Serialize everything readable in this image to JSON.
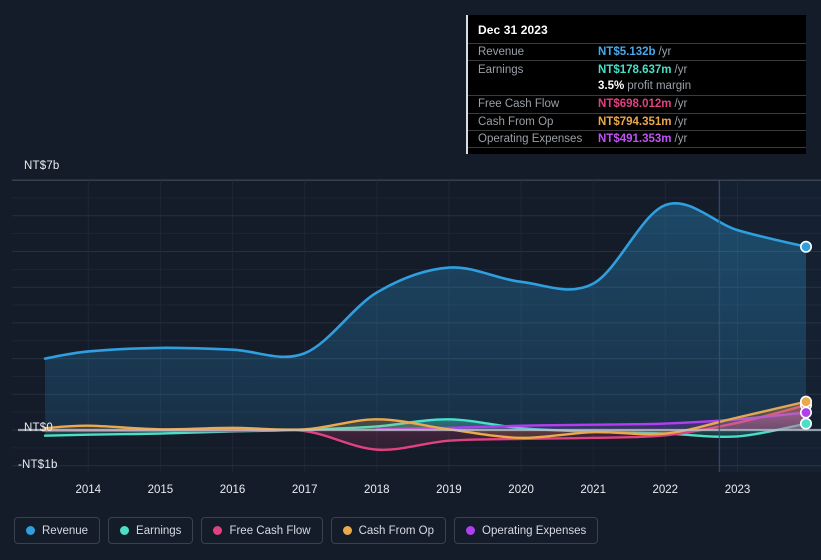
{
  "chart_data": {
    "type": "area",
    "title": "",
    "xlabel": "",
    "ylabel": "",
    "currency": "NT$",
    "ylim": [
      -1,
      7
    ],
    "y_ticks": [
      {
        "label": "NT$7b",
        "value": 7
      },
      {
        "label": "NT$0",
        "value": 0
      },
      {
        "label": "-NT$1b",
        "value": -1
      }
    ],
    "grid": true,
    "legend_position": "bottom",
    "categories": [
      "2014",
      "2015",
      "2016",
      "2017",
      "2018",
      "2019",
      "2020",
      "2021",
      "2022",
      "2023"
    ],
    "x": [
      2013.4,
      2014,
      2015,
      2016,
      2017,
      2018,
      2019,
      2020,
      2021,
      2022,
      2023,
      2023.95
    ],
    "forecast_divider_x": 2022.75,
    "series": [
      {
        "name": "Revenue",
        "color": "#2f9fdf",
        "values": [
          2.0,
          2.2,
          2.3,
          2.25,
          2.15,
          3.85,
          4.55,
          4.15,
          4.1,
          6.3,
          5.6,
          5.132
        ]
      },
      {
        "name": "Earnings",
        "color": "#4adfc8",
        "values": [
          -0.16,
          -0.13,
          -0.1,
          -0.04,
          0.01,
          0.1,
          0.3,
          0.05,
          -0.05,
          -0.1,
          -0.18,
          0.178637
        ]
      },
      {
        "name": "Free Cash Flow",
        "color": "#e0427f",
        "values": [
          -0.02,
          -0.02,
          -0.02,
          -0.03,
          -0.03,
          -0.55,
          -0.3,
          -0.25,
          -0.22,
          -0.15,
          0.2,
          0.698012
        ]
      },
      {
        "name": "Cash From Op",
        "color": "#eba94c",
        "values": [
          0.05,
          0.12,
          0.02,
          0.06,
          0.02,
          0.3,
          0.02,
          -0.22,
          -0.06,
          -0.1,
          0.35,
          0.794351
        ]
      },
      {
        "name": "Operating Expenses",
        "color": "#b03ff0",
        "values": [
          null,
          null,
          null,
          null,
          null,
          0.02,
          0.06,
          0.12,
          0.15,
          0.18,
          0.3,
          0.491353
        ]
      }
    ]
  },
  "tooltip": {
    "date": "Dec 31 2023",
    "rows": [
      {
        "label": "Revenue",
        "value": "NT$5.132b",
        "unit": "/yr",
        "color": "#4aa8e8"
      },
      {
        "label": "Earnings",
        "value": "NT$178.637m",
        "unit": "/yr",
        "color": "#4adfc8"
      },
      {
        "label": "",
        "value": "3.5%",
        "unit": "profit margin",
        "color": "#ffffff"
      },
      {
        "label": "Free Cash Flow",
        "value": "NT$698.012m",
        "unit": "/yr",
        "color": "#e0427f"
      },
      {
        "label": "Cash From Op",
        "value": "NT$794.351m",
        "unit": "/yr",
        "color": "#eba94c"
      },
      {
        "label": "Operating Expenses",
        "value": "NT$491.353m",
        "unit": "/yr",
        "color": "#c152f5"
      }
    ]
  },
  "legend": {
    "items": [
      {
        "label": "Revenue",
        "color": "#2f9fdf"
      },
      {
        "label": "Earnings",
        "color": "#4adfc8"
      },
      {
        "label": "Free Cash Flow",
        "color": "#e0427f"
      },
      {
        "label": "Cash From Op",
        "color": "#eba94c"
      },
      {
        "label": "Operating Expenses",
        "color": "#b03ff0"
      }
    ]
  },
  "axis": {
    "y_top_label": "NT$7b",
    "y_zero_label": "NT$0",
    "y_neg_label": "-NT$1b",
    "x_labels": [
      "2014",
      "2015",
      "2016",
      "2017",
      "2018",
      "2019",
      "2020",
      "2021",
      "2022",
      "2023"
    ]
  }
}
